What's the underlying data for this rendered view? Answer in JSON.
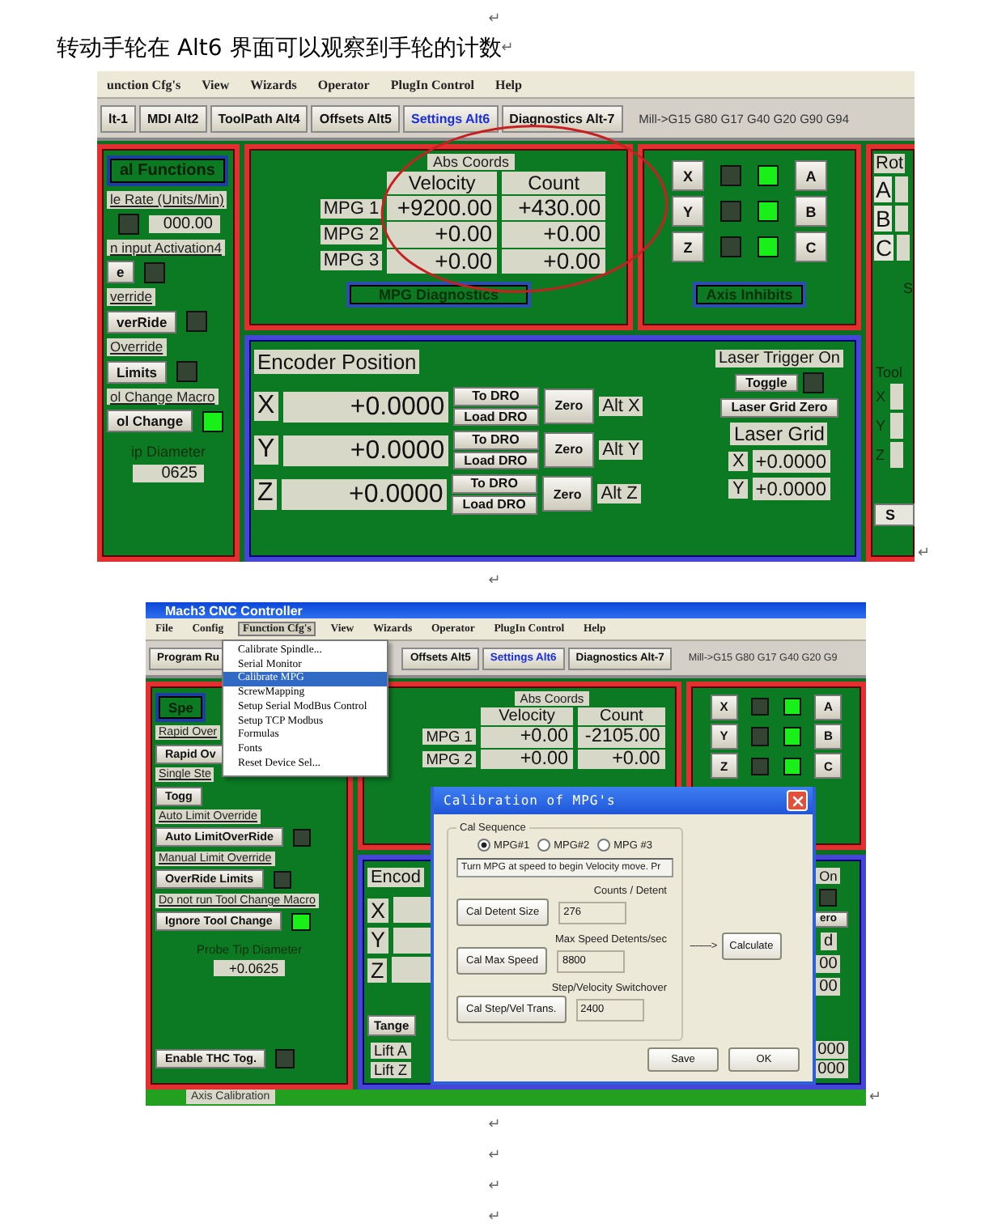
{
  "document": {
    "paragraphs": [
      {
        "kind": "empty",
        "mark": "↵"
      },
      {
        "kind": "text",
        "text": "转动手轮在 Alt6 界面可以观察到手轮的计数",
        "mark": "↵"
      },
      {
        "kind": "screenshot",
        "mark": "↵",
        "screen": {
          "circled": true,
          "menu": [
            {
              "label": "unction Cfg's",
              "selected": false
            },
            {
              "label": "View",
              "selected": false
            },
            {
              "label": "Wizards",
              "selected": false
            },
            {
              "label": "Operator",
              "selected": false
            },
            {
              "label": "PlugIn Control",
              "selected": false
            },
            {
              "label": "Help",
              "selected": false
            }
          ],
          "tabs": [
            {
              "label": "lt-1",
              "selected": false
            },
            {
              "label": "MDI Alt2",
              "selected": false
            },
            {
              "label": "ToolPath Alt4",
              "selected": false
            },
            {
              "label": "Offsets Alt5",
              "selected": false
            },
            {
              "label": "Settings Alt6",
              "selected": true
            },
            {
              "label": "Diagnostics Alt-7",
              "selected": false
            }
          ],
          "gcode": "Mill->G15  G80 G17 G40 G20 G90 G94",
          "left_panel": {
            "items": [
              {
                "kind": "frame_button",
                "label": "al Functions"
              },
              {
                "kind": "label",
                "text": "le Rate (Units/Min)"
              },
              {
                "kind": "field",
                "value": "000.00",
                "led": false
              },
              {
                "kind": "label",
                "text": "n input Activation4"
              },
              {
                "kind": "button",
                "label": "e",
                "led": false
              },
              {
                "kind": "label",
                "text": "verride"
              },
              {
                "kind": "button",
                "label": "verRide",
                "led": false
              },
              {
                "kind": "label",
                "text": "Override"
              },
              {
                "kind": "button",
                "label": "Limits",
                "led": false
              },
              {
                "kind": "label",
                "text": "ol Change Macro"
              },
              {
                "kind": "button",
                "label": "ol Change",
                "led": true
              },
              {
                "kind": "caption",
                "text": "ip Diameter"
              },
              {
                "kind": "field",
                "value": "0625"
              }
            ]
          },
          "mpg_panel": {
            "caption": "Abs Coords",
            "headers": [
              "Velocity",
              "Count"
            ],
            "rows": [
              {
                "label": "MPG 1",
                "velocity": "+9200.00",
                "count": "+430.00"
              },
              {
                "label": "MPG 2",
                "velocity": "+0.00",
                "count": "+0.00"
              },
              {
                "label": "MPG 3",
                "velocity": "+0.00",
                "count": "+0.00"
              }
            ],
            "button": "MPG Diagnostics"
          },
          "axis_panel": {
            "rows": [
              {
                "left": "X",
                "left_on": false,
                "right_on": true,
                "right": "A"
              },
              {
                "left": "Y",
                "left_on": false,
                "right_on": true,
                "right": "B"
              },
              {
                "left": "Z",
                "left_on": false,
                "right_on": true,
                "right": "C"
              }
            ],
            "button": "Axis Inhibits"
          },
          "right_panel": {
            "title": "Rot",
            "axes": [
              "A",
              "B",
              "C"
            ],
            "note": "S",
            "tool_label": "Tool",
            "tool_axes": [
              "X",
              "Y",
              "Z"
            ],
            "button": "S"
          },
          "encoder_panel": {
            "title": "Encoder Position",
            "rows": [
              {
                "axis": "X",
                "value": "+0.0000",
                "to_dro": "To DRO",
                "load_dro": "Load DRO",
                "zero": "Zero",
                "alt": "Alt X"
              },
              {
                "axis": "Y",
                "value": "+0.0000",
                "to_dro": "To DRO",
                "load_dro": "Load DRO",
                "zero": "Zero",
                "alt": "Alt Y"
              },
              {
                "axis": "Z",
                "value": "+0.0000",
                "to_dro": "To DRO",
                "load_dro": "Load DRO",
                "zero": "Zero",
                "alt": "Alt Z"
              }
            ],
            "laser": {
              "title": "Laser Trigger On",
              "toggle": "Toggle",
              "led": false,
              "zero": "Laser Grid Zero",
              "grid": "Laser Grid",
              "rows": [
                {
                  "axis": "X",
                  "value": "+0.0000"
                },
                {
                  "axis": "Y",
                  "value": "+0.0000"
                }
              ]
            }
          }
        }
      },
      {
        "kind": "empty",
        "mark": "↵"
      },
      {
        "kind": "screenshot",
        "mark": "↵",
        "screen": {
          "title": "Mach3 CNC Controller",
          "menu": [
            {
              "label": "File",
              "selected": false
            },
            {
              "label": "Config",
              "selected": false
            },
            {
              "label": "Function Cfg's",
              "selected": true
            },
            {
              "label": "View",
              "selected": false
            },
            {
              "label": "Wizards",
              "selected": false
            },
            {
              "label": "Operator",
              "selected": false
            },
            {
              "label": "PlugIn Control",
              "selected": false
            },
            {
              "label": "Help",
              "selected": false
            }
          ],
          "tabs": [
            {
              "label": "Program Ru",
              "selected": false
            },
            {
              "label": "Offsets Alt5",
              "selected": false
            },
            {
              "label": "Settings Alt6",
              "selected": true
            },
            {
              "label": "Diagnostics Alt-7",
              "selected": false
            }
          ],
          "gcode": "Mill->G15  G80 G17 G40 G20 G9",
          "left_panel": {
            "items": [
              {
                "kind": "frame_button",
                "label": "Spe"
              },
              {
                "kind": "label",
                "text": "Rapid Over"
              },
              {
                "kind": "button",
                "label": "Rapid Ov"
              },
              {
                "kind": "label",
                "text": "Single Ste"
              },
              {
                "kind": "button",
                "label": "Togg"
              },
              {
                "kind": "label",
                "text": "Auto Limit Override"
              },
              {
                "kind": "button",
                "label": "Auto LimitOverRide",
                "led": false
              },
              {
                "kind": "label",
                "text": "Manual Limit Override"
              },
              {
                "kind": "button",
                "label": "OverRide Limits",
                "led": false
              },
              {
                "kind": "label",
                "text": "Do not run Tool Change Macro"
              },
              {
                "kind": "button",
                "label": "Ignore Tool Change",
                "led": true
              },
              {
                "kind": "caption",
                "text": "Probe Tip Diameter"
              },
              {
                "kind": "field",
                "value": "+0.0625"
              }
            ],
            "footer": [
              {
                "kind": "button",
                "label": "Enable THC Tog.",
                "led": false
              }
            ]
          },
          "mpg_panel": {
            "caption": "Abs Coords",
            "headers": [
              "Velocity",
              "Count"
            ],
            "rows": [
              {
                "label": "MPG 1",
                "velocity": "+0.00",
                "count": "-2105.00"
              },
              {
                "label": "MPG 2",
                "velocity": "+0.00",
                "count": "+0.00"
              }
            ]
          },
          "axis_panel": {
            "rows": [
              {
                "left": "X",
                "left_on": false,
                "right_on": true,
                "right": "A"
              },
              {
                "left": "Y",
                "left_on": false,
                "right_on": true,
                "right": "B"
              },
              {
                "left": "Z",
                "left_on": false,
                "right_on": true,
                "right": "C"
              }
            ]
          },
          "encoder_panel": {
            "title": "Encod",
            "rows": [
              {
                "axis": "X"
              },
              {
                "axis": "Y"
              },
              {
                "axis": "Z"
              }
            ],
            "laser": {
              "title": "On",
              "led": false,
              "zero": "ero",
              "grid": "d",
              "rows": [
                {
                  "value": "00"
                },
                {
                  "value": "00"
                }
              ]
            },
            "lower": {
              "button": "Tange",
              "rows": [
                {
                  "label": "Lift A",
                  "value": "000"
                },
                {
                  "label": "Lift Z",
                  "value": "000"
                }
              ]
            }
          },
          "footer": "Axis Calibration",
          "dropdown": [
            {
              "label": "Calibrate Spindle...",
              "selected": false
            },
            {
              "label": "Serial Monitor",
              "selected": false
            },
            {
              "label": "Calibrate MPG",
              "selected": true
            },
            {
              "label": "ScrewMapping",
              "selected": false
            },
            {
              "label": "Setup Serial ModBus Control",
              "selected": false
            },
            {
              "label": "Setup TCP Modbus",
              "selected": false
            },
            {
              "label": "Formulas",
              "selected": false
            },
            {
              "label": "Fonts",
              "selected": false
            },
            {
              "label": "Reset Device Sel...",
              "selected": false
            }
          ],
          "dialog": {
            "title": "Calibration of MPG's",
            "group": "Cal Sequence",
            "radios": [
              {
                "label": "MPG#1",
                "selected": true
              },
              {
                "label": "MPG#2",
                "selected": false
              },
              {
                "label": "MPG #3",
                "selected": false
              }
            ],
            "message": "Turn MPG at speed to begin Velocity move. Pr",
            "steps": [
              {
                "caption": "Counts / Detent",
                "button": "Cal Detent Size",
                "value": "276"
              },
              {
                "caption": "Max Speed Detents/sec",
                "button": "Cal Max Speed",
                "value": "8800"
              },
              {
                "caption": "Step/Velocity Switchover",
                "button": "Cal Step/Vel Trans.",
                "value": "2400"
              }
            ],
            "arrow": "-------->",
            "calculate": "Calculate",
            "buttons": [
              "Save",
              "OK"
            ]
          }
        }
      },
      {
        "kind": "empty",
        "mark": "↵"
      },
      {
        "kind": "empty",
        "mark": "↵"
      },
      {
        "kind": "empty",
        "mark": "↵"
      },
      {
        "kind": "empty",
        "mark": "↵"
      }
    ]
  }
}
